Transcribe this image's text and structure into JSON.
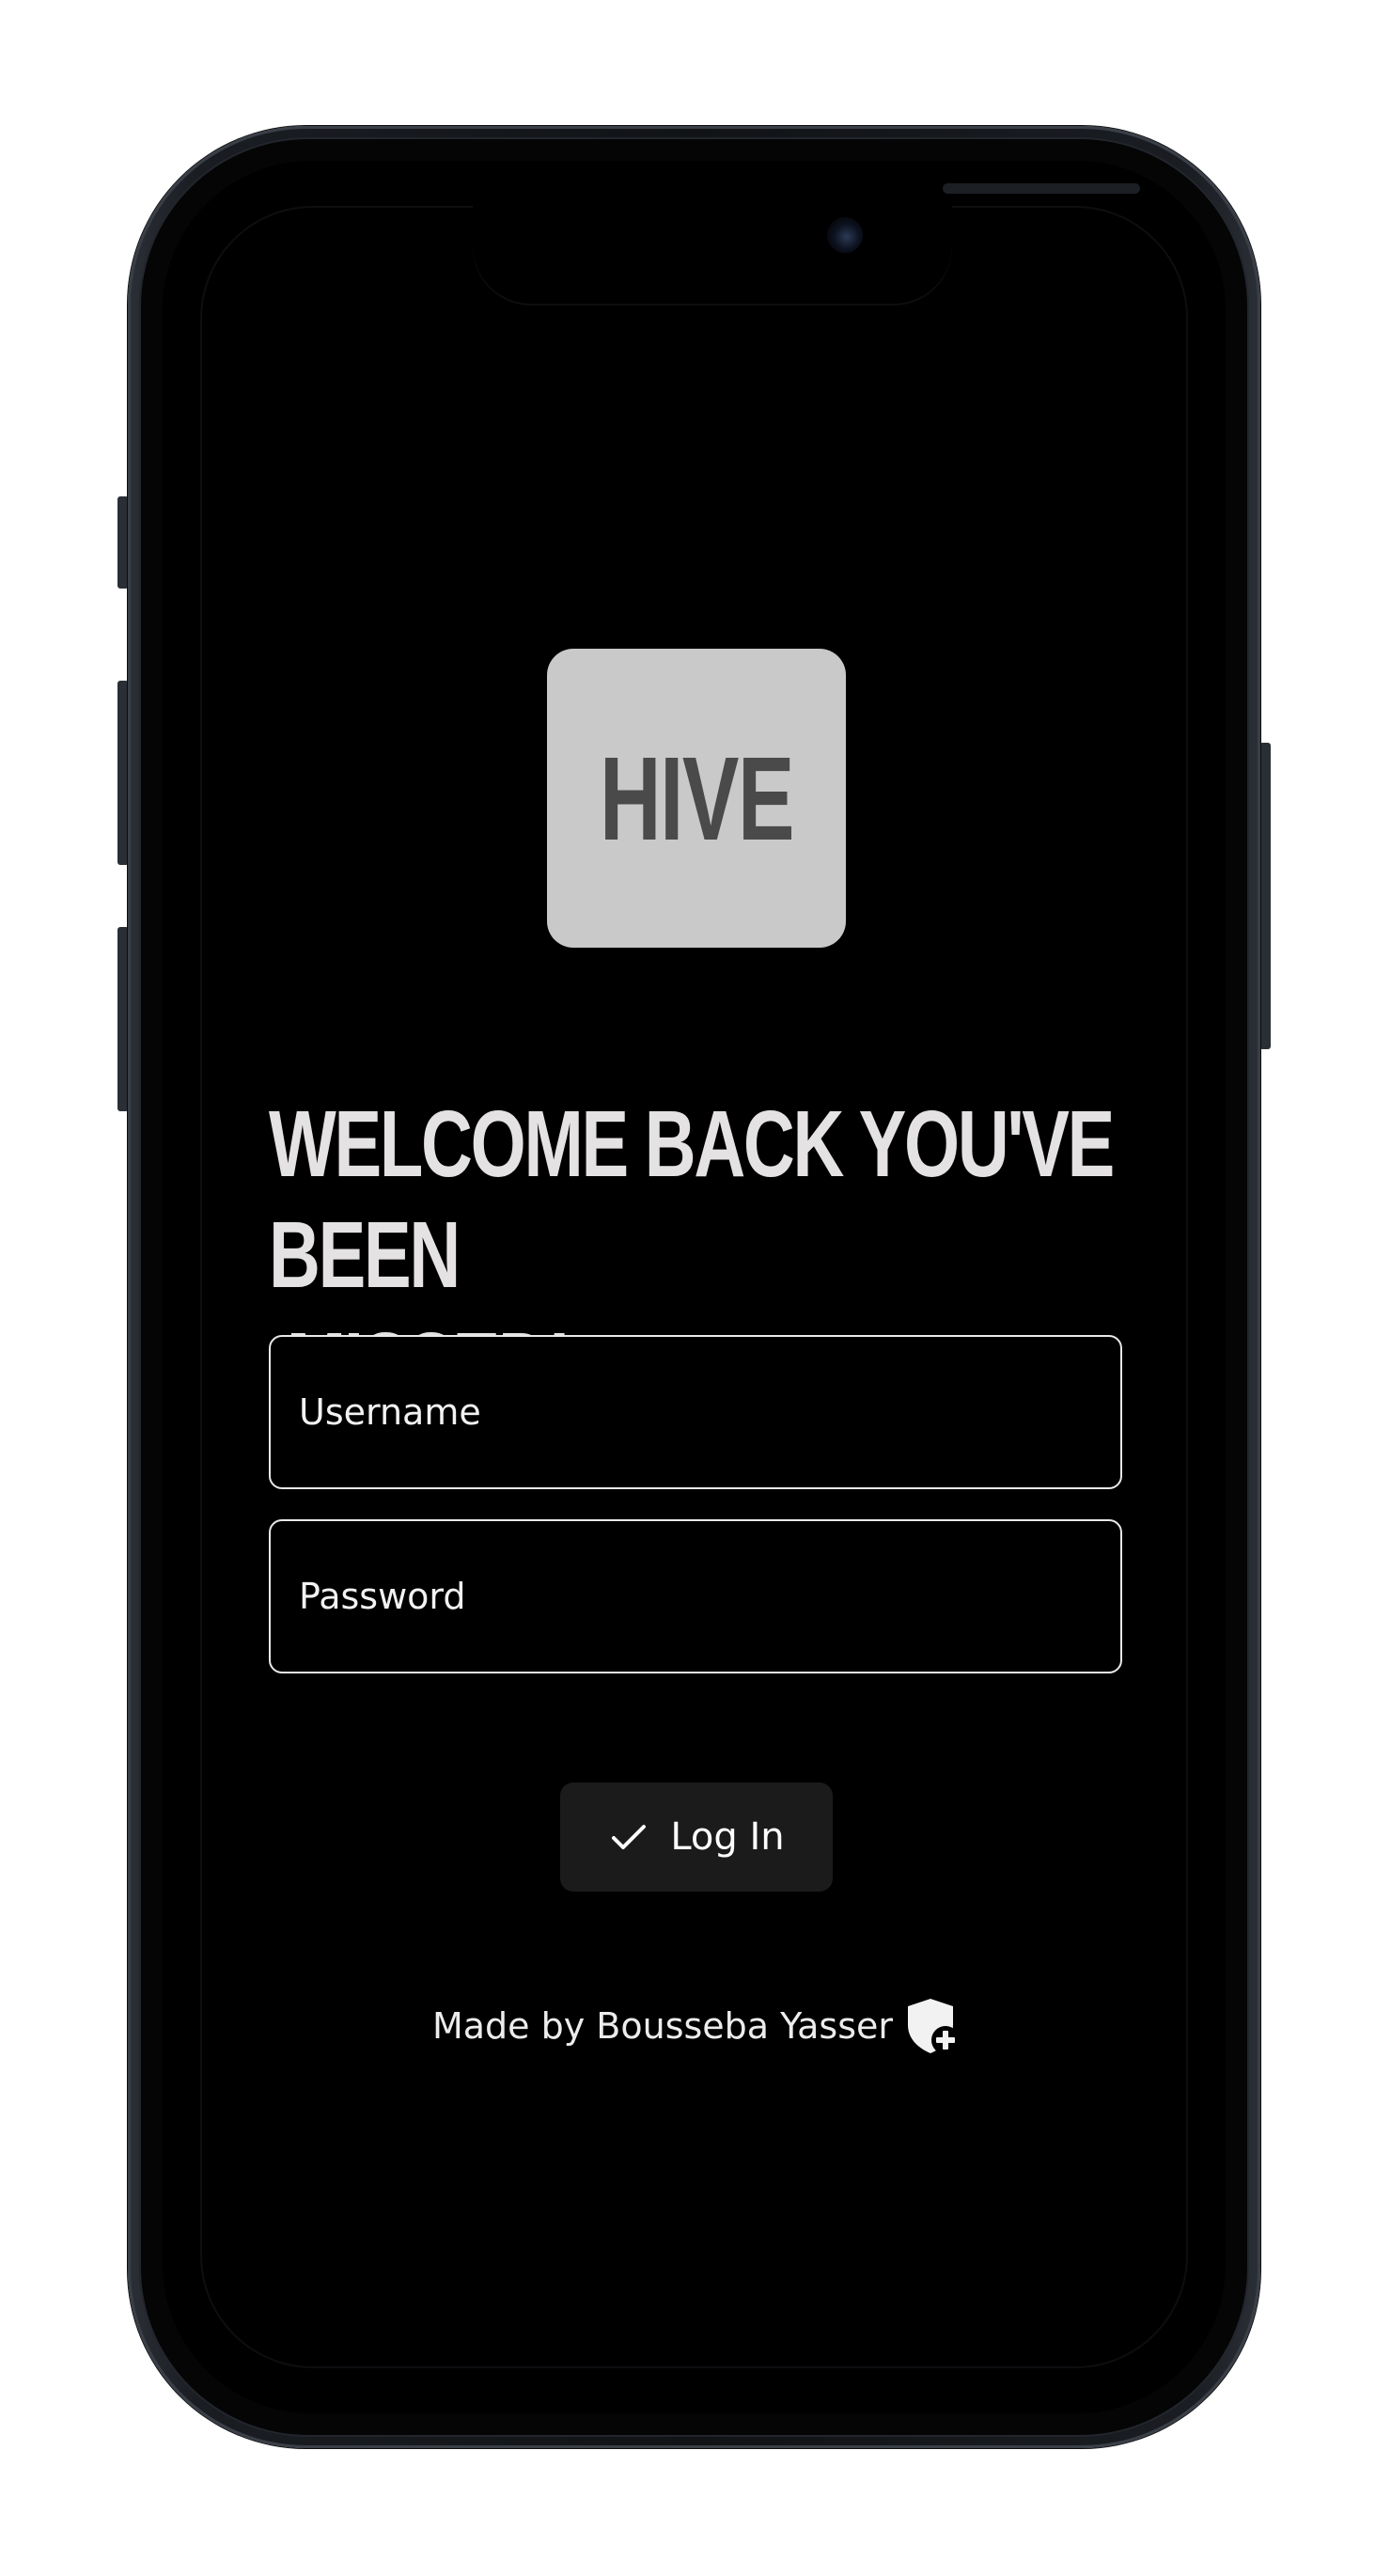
{
  "app": {
    "logo_text": "HIVE",
    "welcome_title": "WELCOME BACK YOU'VE  BEEN\n MISSED!"
  },
  "form": {
    "username_placeholder": "Username",
    "password_placeholder": "Password",
    "login_label": "Log In",
    "login_icon": "check-icon"
  },
  "footer": {
    "credit_text": "Made by Bousseba Yasser",
    "icon": "shield-plus-icon"
  },
  "colors": {
    "screen_background": "#000000",
    "logo_tile": "#c9c9c9",
    "logo_text": "#4a4a4a",
    "title": "#e4e2e3",
    "button_background": "#1b1b1b"
  }
}
